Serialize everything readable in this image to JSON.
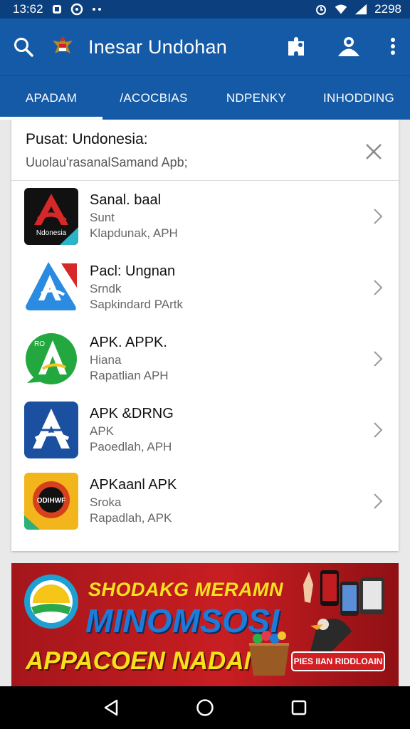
{
  "status_bar": {
    "time": "13:62",
    "battery_text": "2298",
    "icons": [
      "notification-icon",
      "sync-icon",
      "more-dots-icon",
      "alarm-icon",
      "wifi-icon",
      "signal-icon"
    ]
  },
  "app_bar": {
    "title": "Inesar Undohan",
    "icons": [
      "search-icon",
      "emblem-icon",
      "puzzle-icon",
      "account-icon",
      "overflow-menu-icon"
    ],
    "color": "#155aa6"
  },
  "tabs": [
    {
      "label": "APADAM",
      "active": true
    },
    {
      "label": "/ACOCBIAS",
      "active": false
    },
    {
      "label": "NDPENKY",
      "active": false
    },
    {
      "label": "INHODDING",
      "active": false
    }
  ],
  "search": {
    "title": "Pusat: Undonesia:",
    "value": "Uuolau'rasanalSamand Apb;"
  },
  "apps": [
    {
      "name": "Sanal. baal",
      "line1": "Sunt",
      "line2": "Klapdunak, APH",
      "icon_text": "Ndonesia",
      "icon": "red-a-logo-icon"
    },
    {
      "name": "Pacl: Ungnan",
      "line1": "Srndk",
      "line2": "Sapkindard PArtk",
      "icon_text": "",
      "icon": "blue-a-logo-icon"
    },
    {
      "name": "APK. APPK.",
      "line1": "Hiana",
      "line2": "Rapatlian APH",
      "icon_text": "RO",
      "icon": "green-a-logo-icon"
    },
    {
      "name": "APK &DRNG",
      "line1": "APK",
      "line2": "Paoedlah, APH",
      "icon_text": "",
      "icon": "navy-a-logo-icon"
    },
    {
      "name": "APKaanl APK",
      "line1": "Sroka",
      "line2": "Rapadlah, APK",
      "icon_text": "ODIHWF",
      "icon": "sun-badge-icon"
    }
  ],
  "banner": {
    "line1": "SHODAKG MERAMN",
    "line2": "MINOMSOSI",
    "line3": "APPACOEN NADAN!",
    "button": "PIES IIAN RIDDLOAIN"
  },
  "nav_bar": {
    "icons": [
      "back-icon",
      "home-icon",
      "recents-icon"
    ]
  }
}
